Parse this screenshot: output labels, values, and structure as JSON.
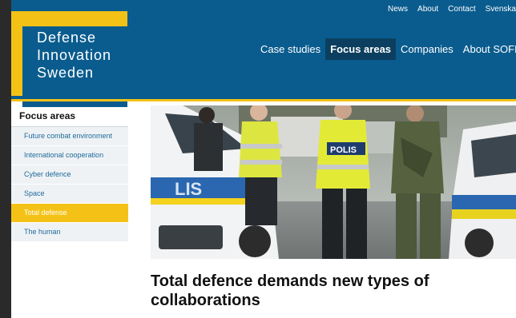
{
  "logo": {
    "text": "Defense\nInnovation\nSweden"
  },
  "top_links": [
    "News",
    "About",
    "Contact",
    "Svenska"
  ],
  "main_nav": [
    {
      "label": "Case studies",
      "active": false
    },
    {
      "label": "Focus areas",
      "active": true
    },
    {
      "label": "Companies",
      "active": false
    },
    {
      "label": "About SOFF",
      "active": false
    }
  ],
  "sidebar": {
    "title": "Focus areas",
    "items": [
      {
        "label": "Future combat environment",
        "active": false
      },
      {
        "label": "International cooperation",
        "active": false
      },
      {
        "label": "Cyber defence",
        "active": false
      },
      {
        "label": "Space",
        "active": false
      },
      {
        "label": "Total defense",
        "active": true
      },
      {
        "label": "The human",
        "active": false
      }
    ]
  },
  "hero": {
    "vehicle_text": "LIS",
    "vest_text": "POLIS"
  },
  "article": {
    "headline": "Total defence demands new types of collaborations"
  },
  "colors": {
    "brand_blue": "#0a5c8e",
    "brand_yellow": "#f4c217",
    "nav_active": "#0c3f5f",
    "link_blue": "#1f6a9b"
  }
}
